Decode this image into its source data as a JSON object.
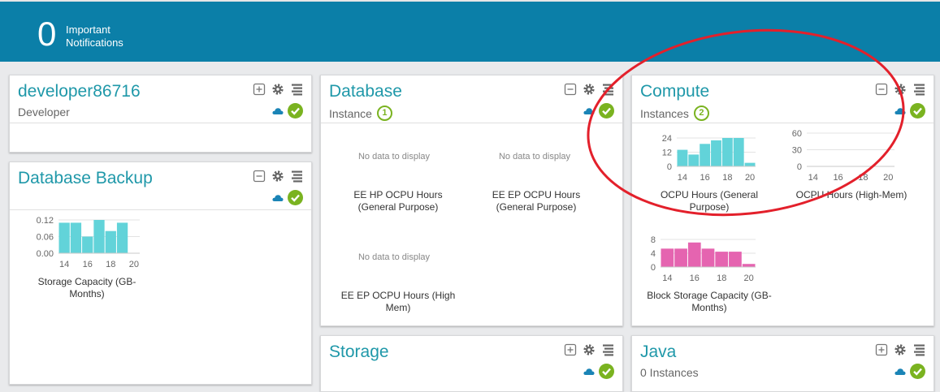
{
  "header": {
    "notification_count": "0",
    "notification_label_1": "Important",
    "notification_label_2": "Notifications"
  },
  "cards": {
    "developer": {
      "title": "developer86716",
      "subtitle": "Developer"
    },
    "db_backup": {
      "title": "Database Backup"
    },
    "database": {
      "title": "Database",
      "subtitle": "Instance",
      "count": "1",
      "charts": [
        {
          "nodata": "No data to display",
          "caption_1": "EE HP OCPU Hours",
          "caption_2": "(General Purpose)"
        },
        {
          "nodata": "No data to display",
          "caption_1": "EE EP OCPU Hours",
          "caption_2": "(General Purpose)"
        },
        {
          "nodata": "No data to display",
          "caption_1": "EE EP OCPU Hours (High",
          "caption_2": "Mem)"
        }
      ]
    },
    "compute": {
      "title": "Compute",
      "subtitle": "Instances",
      "count": "2"
    },
    "storage": {
      "title": "Storage"
    },
    "java": {
      "title": "Java",
      "subtitle": "0 Instances"
    }
  },
  "chart_data": [
    {
      "id": "storage_capacity",
      "type": "bar",
      "caption": [
        "Storage Capacity (GB-",
        "Months)"
      ],
      "x": [
        14,
        15,
        16,
        17,
        18,
        19
      ],
      "values": [
        0.11,
        0.11,
        0.06,
        0.12,
        0.08,
        0.11
      ],
      "xticks": [
        "14",
        "16",
        "18",
        "20"
      ],
      "yticks": [
        "0.12",
        "0.06",
        "0.00"
      ],
      "ylim": [
        0,
        0.12
      ],
      "color": "#62d3d9"
    },
    {
      "id": "ocpu_general",
      "type": "bar",
      "caption": [
        "OCPU Hours (General",
        "Purpose)"
      ],
      "x": [
        14,
        15,
        16,
        17,
        18,
        19,
        20
      ],
      "values": [
        14,
        10,
        19,
        22,
        24,
        24,
        3
      ],
      "xticks": [
        "14",
        "16",
        "18",
        "20"
      ],
      "yticks": [
        "24",
        "12",
        "0"
      ],
      "ylim": [
        0,
        24
      ],
      "color": "#62d3d9"
    },
    {
      "id": "ocpu_highmem",
      "type": "bar",
      "caption": [
        "OCPU Hours (High-Mem)"
      ],
      "x": [],
      "values": [],
      "xticks": [
        "14",
        "16",
        "18",
        "20"
      ],
      "yticks": [
        "60",
        "30",
        "0"
      ],
      "ylim": [
        0,
        60
      ],
      "color": "#62d3d9"
    },
    {
      "id": "block_storage",
      "type": "bar",
      "caption": [
        "Block Storage Capacity (GB-",
        "Months)"
      ],
      "x": [
        14,
        15,
        16,
        17,
        18,
        19,
        20
      ],
      "values": [
        6,
        6,
        8,
        6,
        5,
        5,
        1
      ],
      "xticks": [
        "14",
        "16",
        "18",
        "20"
      ],
      "yticks": [
        "8",
        "4",
        "0"
      ],
      "ylim": [
        0,
        9
      ],
      "color": "#e564b0"
    }
  ],
  "colors": {
    "header_bg": "#0b7fa8",
    "title": "#1f98a9",
    "ok_green": "#7ab320",
    "cloud_blue": "#1a84b6",
    "annotation_red": "#e3202b"
  }
}
